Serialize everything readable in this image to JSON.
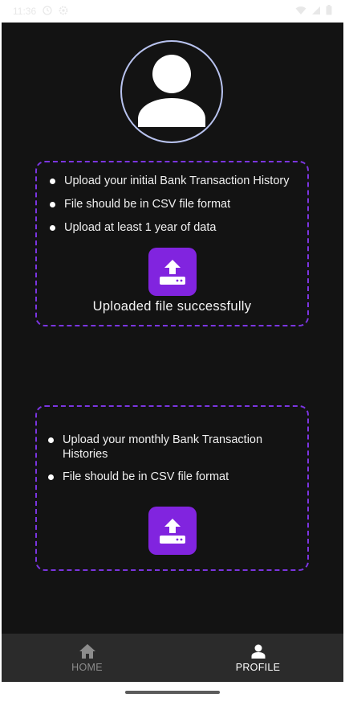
{
  "status_bar": {
    "time": "11:36",
    "icons": [
      "clock-icon",
      "settings-icon",
      "wifi-icon",
      "signal-icon",
      "battery-icon"
    ]
  },
  "profile": {
    "avatar_icon": "person-avatar-icon",
    "avatar_border_color": "#b7c2f0"
  },
  "initial_upload": {
    "bullets": [
      "Upload your initial Bank Transaction History",
      "File should be in CSV file format",
      "Upload at least 1 year of data"
    ],
    "button_icon": "upload-icon",
    "status_message": "Uploaded file successfully"
  },
  "monthly_upload": {
    "bullets": [
      "Upload your monthly Bank Transaction Histories",
      "File should be in CSV file format"
    ],
    "button_icon": "upload-icon"
  },
  "bottom_nav": {
    "items": [
      {
        "label": "HOME",
        "icon": "home-icon",
        "active": false
      },
      {
        "label": "PROFILE",
        "icon": "person-icon",
        "active": true
      }
    ]
  },
  "colors": {
    "accent": "#8124df",
    "dashed_border": "#7b35e0",
    "background": "#131313",
    "nav_background": "#2b2b2b"
  }
}
